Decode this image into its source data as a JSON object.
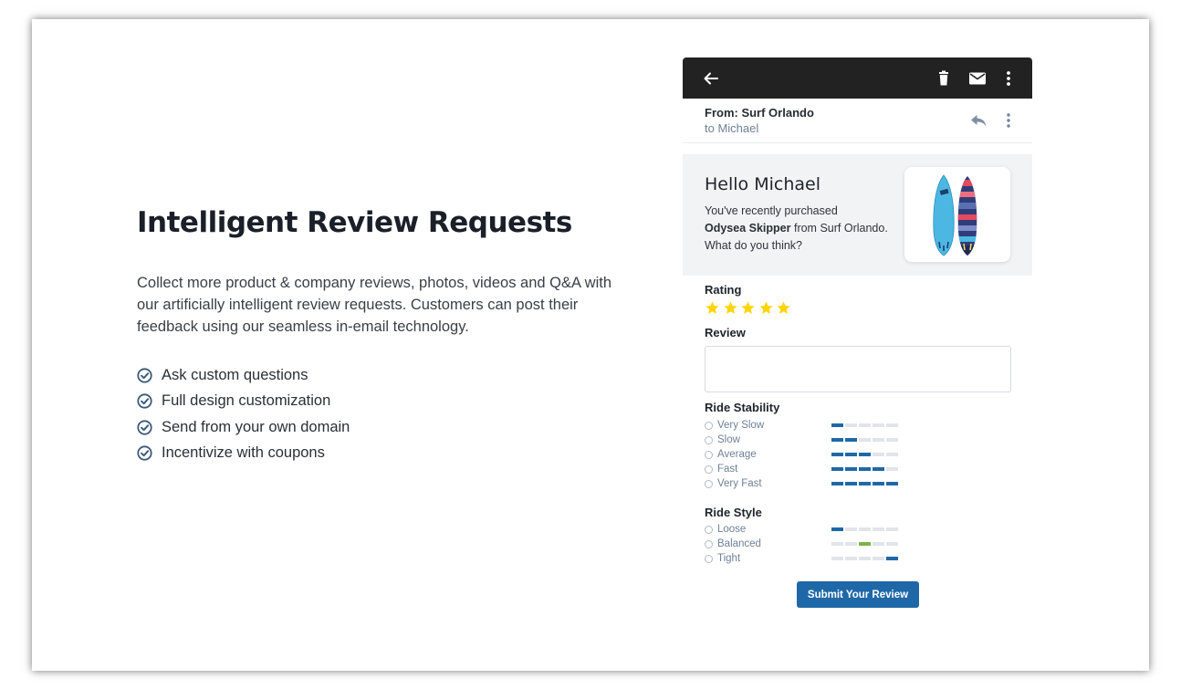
{
  "marketing": {
    "headline": "Intelligent Review Requests",
    "description": "Collect more product & company reviews, photos, videos and Q&A with our artificially intelligent review requests. Customers can post their feedback using our seamless in-email technology.",
    "features": [
      "Ask custom questions",
      "Full design customization",
      "Send from your own domain",
      "Incentivize with coupons"
    ]
  },
  "email": {
    "toolbar_icons": [
      "back-arrow-icon",
      "trash-icon",
      "mail-icon",
      "more-vert-icon"
    ],
    "from": "From: Surf Orlando",
    "to": "to Michael",
    "greeting": "Hello Michael",
    "message": {
      "line1": "You've recently purchased",
      "product_name": "Odysea Skipper",
      "line2_rest": " from Surf Orlando.",
      "line3": "What do you think?"
    },
    "rating": {
      "label": "Rating",
      "stars": 5,
      "star_color": "#ffd400"
    },
    "review": {
      "label": "Review",
      "placeholder": ""
    },
    "ride_stability": {
      "label": "Ride Stability",
      "options": [
        {
          "label": "Very Slow",
          "level": 1
        },
        {
          "label": "Slow",
          "level": 2
        },
        {
          "label": "Average",
          "level": 3
        },
        {
          "label": "Fast",
          "level": 4
        },
        {
          "label": "Very Fast",
          "level": 5
        }
      ]
    },
    "ride_style": {
      "label": "Ride Style",
      "options": [
        {
          "label": "Loose",
          "position": 1
        },
        {
          "label": "Balanced",
          "position": 3
        },
        {
          "label": "Tight",
          "position": 5
        }
      ]
    },
    "submit_label": "Submit Your Review"
  },
  "colors": {
    "accent": "#1f68a8",
    "topbar": "#222222",
    "balanced_green": "#7bb54a",
    "check": "#3b5a78"
  }
}
